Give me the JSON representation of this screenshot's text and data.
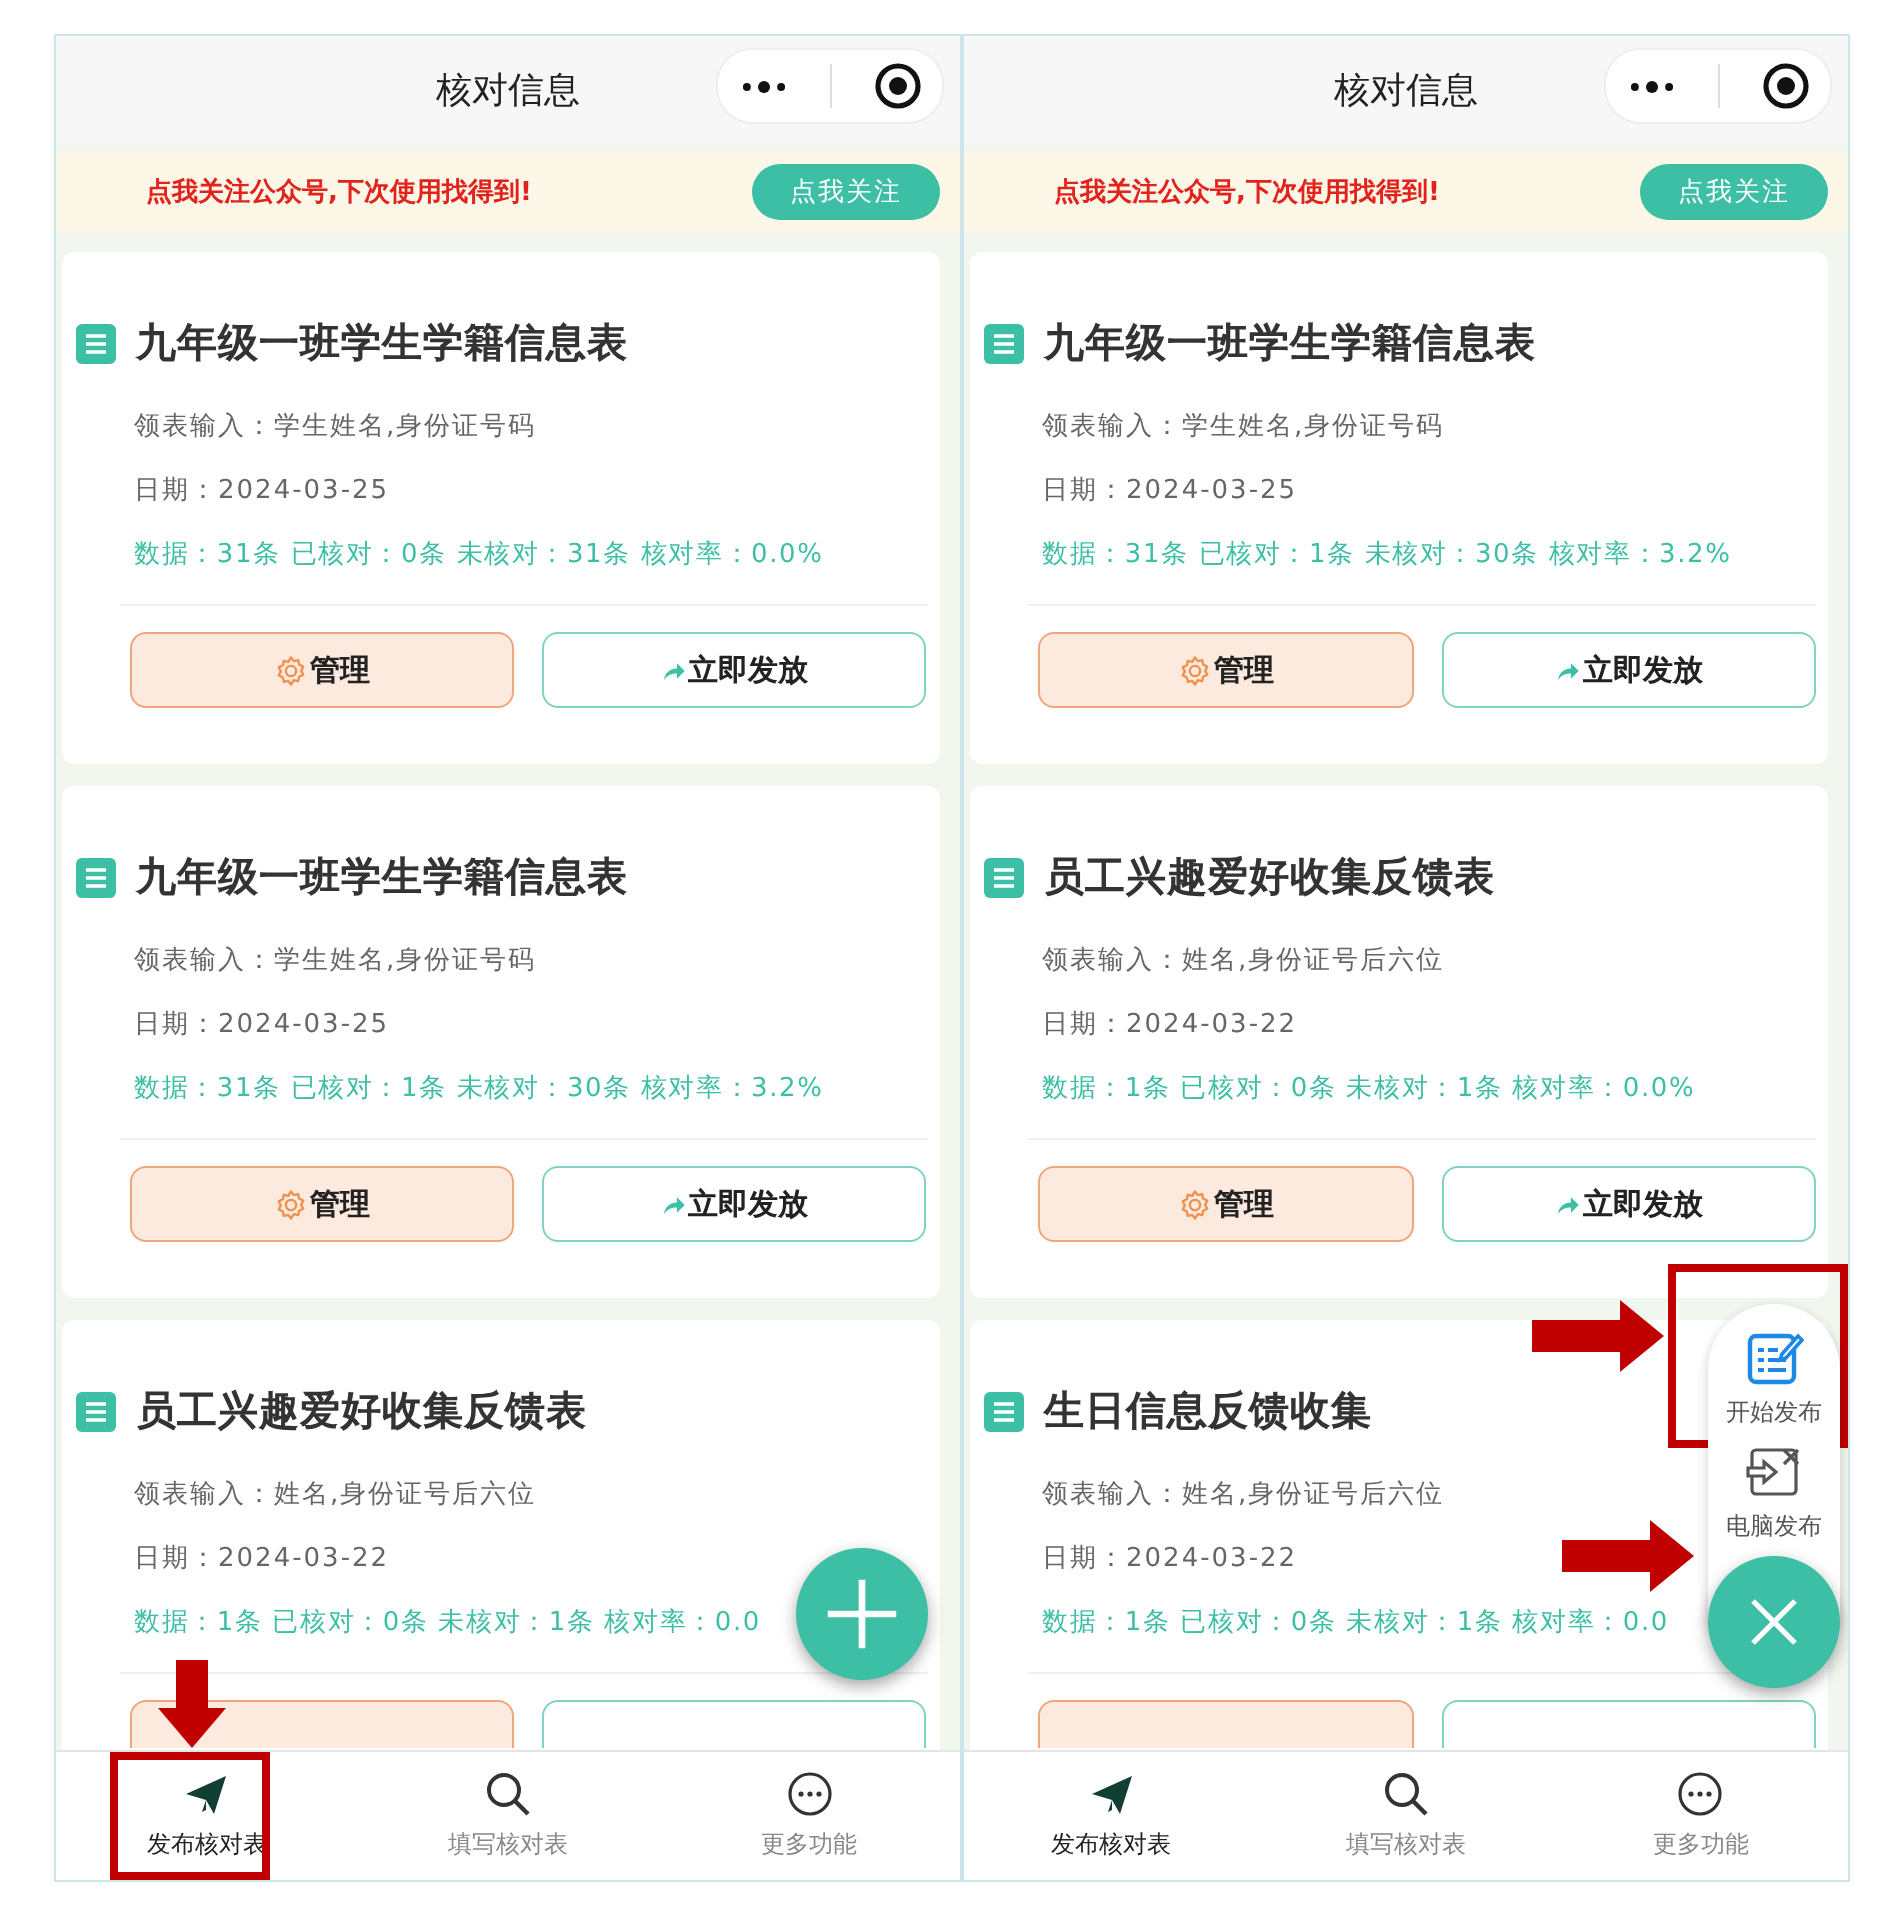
{
  "panels": [
    {
      "header": {
        "title": "核对信息"
      },
      "banner": {
        "text": "点我关注公众号,下次使用找得到!",
        "button": "点我关注"
      },
      "cards": [
        {
          "kind": "full",
          "title": "九年级一班学生学籍信息表",
          "fields": [
            "领表输入：学生姓名,身份证号码",
            "日期：2024-03-25"
          ],
          "stats": "数据：31条 已核对：0条 未核对：31条 核对率：0.0%",
          "buttons": [
            "管理",
            "立即发放"
          ]
        },
        {
          "kind": "full",
          "title": "九年级一班学生学籍信息表",
          "fields": [
            "领表输入：学生姓名,身份证号码",
            "日期：2024-03-25"
          ],
          "stats": "数据：31条 已核对：1条 未核对：30条 核对率：3.2%",
          "buttons": [
            "管理",
            "立即发放"
          ]
        },
        {
          "kind": "cut",
          "title": "员工兴趣爱好收集反馈表",
          "fields": [
            "领表输入：姓名,身份证号后六位",
            "日期：2024-03-22"
          ],
          "stats": "数据：1条 已核对：0条 未核对：1条 核对率：0.0"
        }
      ],
      "fab": {
        "kind": "add"
      },
      "tabs": [
        {
          "label": "发布核对表",
          "selected": true,
          "highlighted": true,
          "pointed": true
        },
        {
          "label": "填写核对表",
          "selected": false
        },
        {
          "label": "更多功能",
          "selected": false
        }
      ]
    },
    {
      "header": {
        "title": "核对信息"
      },
      "banner": {
        "text": "点我关注公众号,下次使用找得到!",
        "button": "点我关注"
      },
      "cards": [
        {
          "kind": "full",
          "title": "九年级一班学生学籍信息表",
          "fields": [
            "领表输入：学生姓名,身份证号码",
            "日期：2024-03-25"
          ],
          "stats": "数据：31条 已核对：1条 未核对：30条 核对率：3.2%",
          "buttons": [
            "管理",
            "立即发放"
          ]
        },
        {
          "kind": "full",
          "title": "员工兴趣爱好收集反馈表",
          "fields": [
            "领表输入：姓名,身份证号后六位",
            "日期：2024-03-22"
          ],
          "stats": "数据：1条 已核对：0条 未核对：1条 核对率：0.0%",
          "buttons": [
            "管理",
            "立即发放"
          ]
        },
        {
          "kind": "cut",
          "title": "生日信息反馈收集",
          "fields": [
            "领表输入：姓名,身份证号后六位",
            "日期：2024-03-22"
          ],
          "stats": "数据：1条 已核对：0条 未核对：1条 核对率：0.0"
        }
      ],
      "fab": {
        "kind": "close",
        "pointed": true,
        "menu": [
          {
            "kind": "edit",
            "label": "开始发布",
            "highlighted": true,
            "pointed": true
          },
          {
            "kind": "pc",
            "label": "电脑发布"
          }
        ]
      },
      "tabs": [
        {
          "label": "发布核对表",
          "selected": true
        },
        {
          "label": "填写核对表",
          "selected": false
        },
        {
          "label": "更多功能",
          "selected": false
        }
      ]
    }
  ]
}
